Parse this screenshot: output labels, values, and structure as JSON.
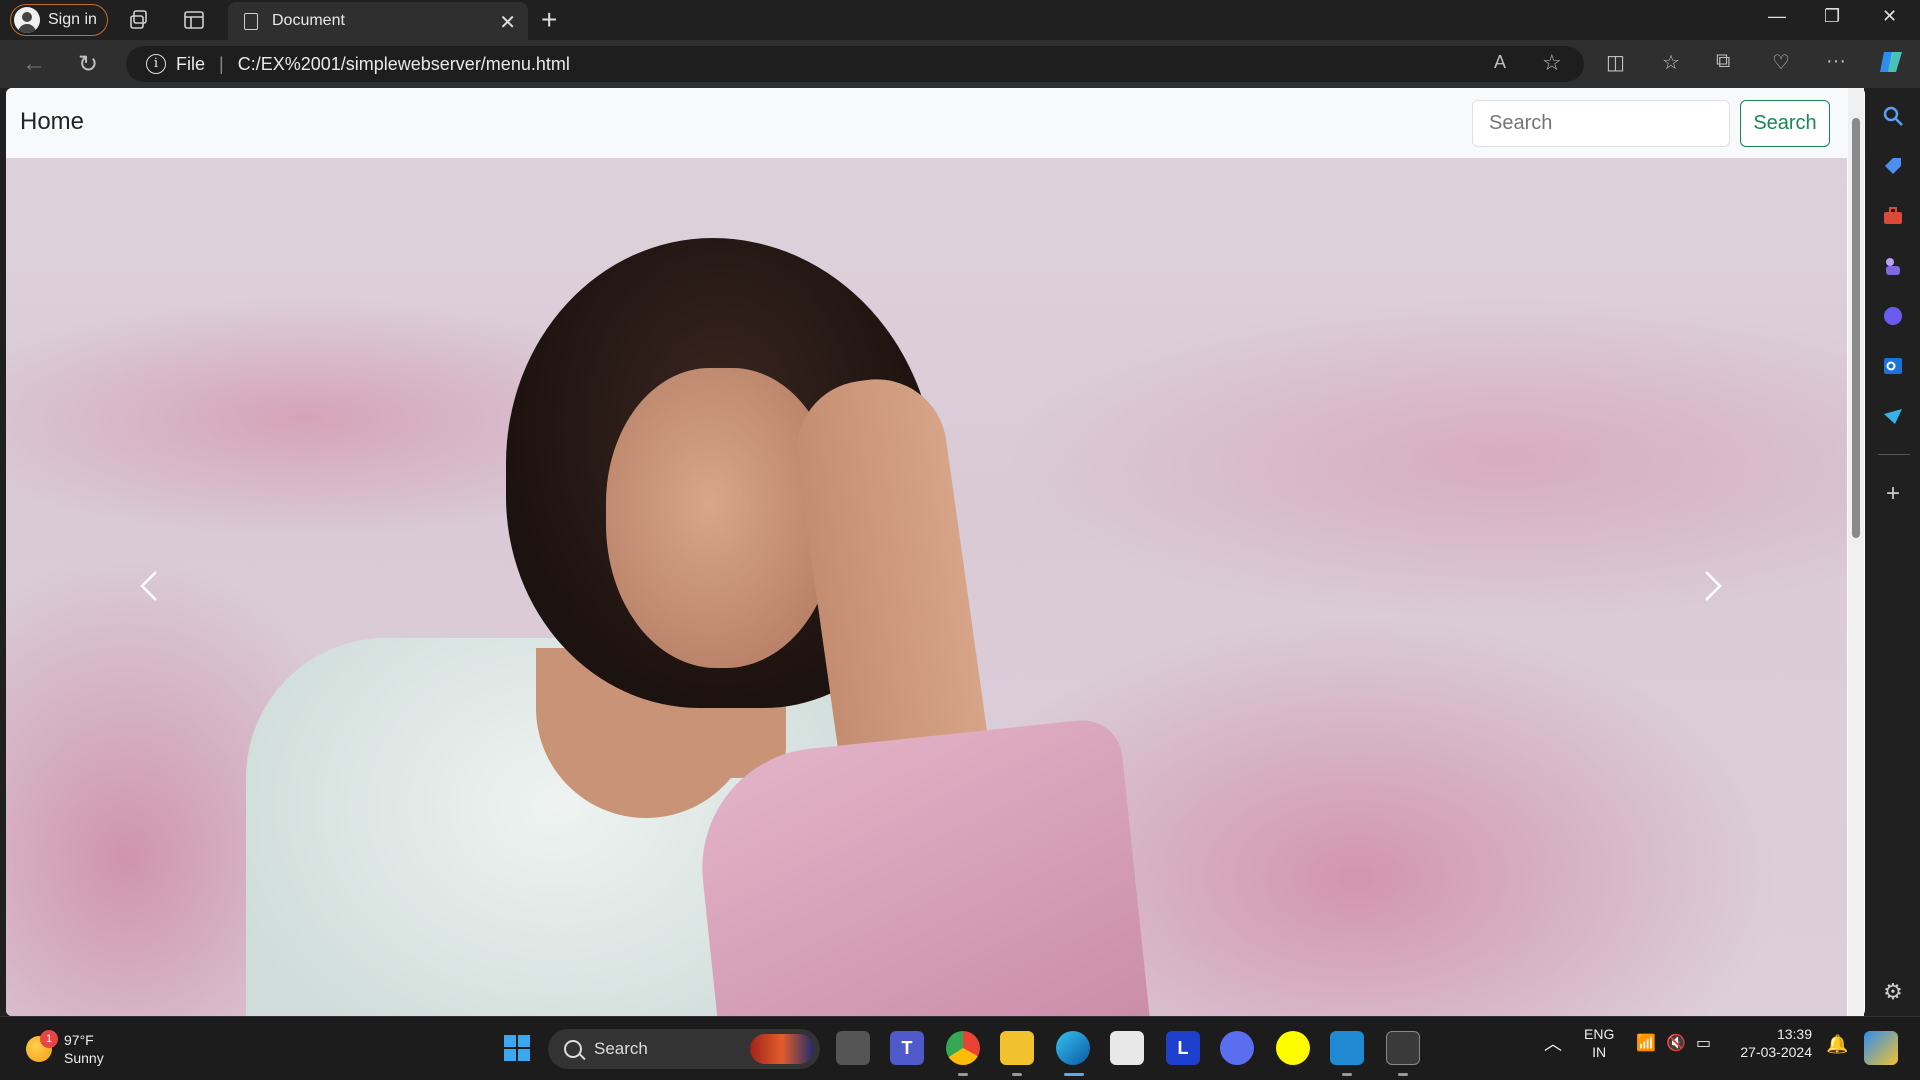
{
  "browser": {
    "signin_label": "Sign in",
    "tab_title": "Document",
    "address_scheme": "File",
    "address_url": "C:/EX%2001/simplewebserver/menu.html"
  },
  "page": {
    "brand": "Home",
    "search_placeholder": "Search",
    "search_button": "Search",
    "carousel_image": "Woman in white top with pink shawl against pink and lavender clouded backdrop",
    "accent_color": "#198754"
  },
  "taskbar": {
    "weather_badge": "1",
    "temperature": "97°F",
    "condition": "Sunny",
    "search_label": "Search",
    "apps": [
      "task-view",
      "teams",
      "chrome",
      "file-explorer",
      "edge",
      "store",
      "l-app",
      "arc-app",
      "snapchat",
      "vscode",
      "terminal"
    ],
    "l_app_letter": "L",
    "lang_line1": "ENG",
    "lang_line2": "IN",
    "time": "13:39",
    "date": "27-03-2024"
  }
}
